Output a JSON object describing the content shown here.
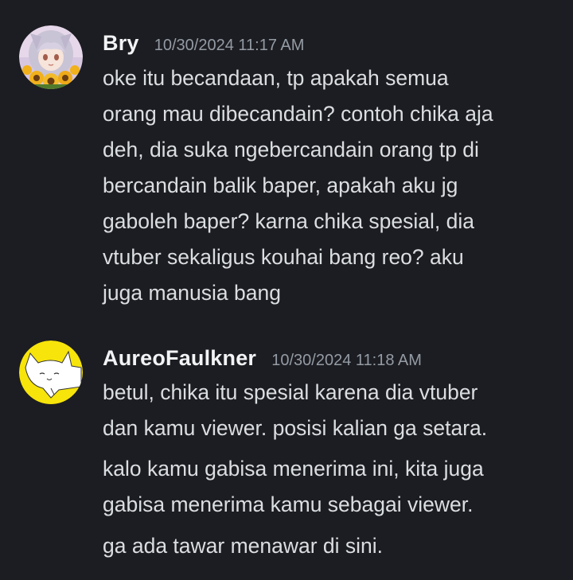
{
  "messages": [
    {
      "username": "Bry",
      "timestamp": "10/30/2024 11:17 AM",
      "avatar": "anime-girl-sunflower-avatar",
      "lines": [
        "oke itu becandaan, tp apakah semua",
        "orang mau dibecandain? contoh chika aja",
        "deh, dia suka ngebercandain orang tp di",
        "bercandain balik baper, apakah aku jg",
        "gaboleh baper? karna chika spesial, dia",
        "vtuber sekaligus kouhai bang reo? aku",
        "juga manusia bang"
      ]
    },
    {
      "username": "AureoFaulkner",
      "timestamp": "10/30/2024 11:18 AM",
      "avatar": "white-cat-drawing-avatar",
      "lines": [
        "betul, chika itu spesial karena dia vtuber",
        "dan kamu viewer. posisi kalian ga setara."
      ],
      "lines2": [
        "kalo kamu gabisa menerima ini, kita juga",
        "gabisa menerima kamu sebagai viewer."
      ],
      "lines3": [
        "ga ada tawar menawar di sini."
      ]
    }
  ],
  "colors": {
    "background": "#1c1d22",
    "username": "#f2f3f5",
    "timestamp": "#949ba4",
    "text": "#dbdee1"
  }
}
